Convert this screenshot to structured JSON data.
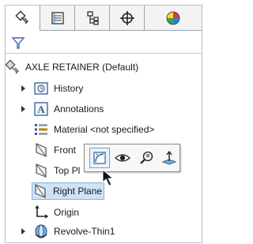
{
  "tabs": [
    {
      "name": "featuremanager-tab",
      "icon": "featuremanager-icon",
      "active": true
    },
    {
      "name": "propertymanager-tab",
      "icon": "propertymanager-icon",
      "active": false
    },
    {
      "name": "configurationmanager-tab",
      "icon": "configurationmanager-icon",
      "active": false
    },
    {
      "name": "dimxpert-tab",
      "icon": "crosshair-icon",
      "active": false
    },
    {
      "name": "display-tab",
      "icon": "color-sphere-icon",
      "active": false
    }
  ],
  "filter": {
    "icon": "filter-icon"
  },
  "tree": {
    "root": {
      "label": "AXLE RETAINER  (Default)",
      "icon": "part-icon"
    },
    "items": [
      {
        "label": "History",
        "icon": "history-icon",
        "expandable": true
      },
      {
        "label": "Annotations",
        "icon": "annotations-icon",
        "expandable": true
      },
      {
        "label": "Material <not specified>",
        "icon": "material-icon",
        "expandable": false
      },
      {
        "label": "Front",
        "icon": "plane-icon",
        "expandable": false
      },
      {
        "label": "Top Pl",
        "icon": "plane-icon",
        "expandable": false
      },
      {
        "label": "Right Plane",
        "icon": "plane-icon",
        "expandable": false,
        "selected": true
      },
      {
        "label": "Origin",
        "icon": "origin-icon",
        "expandable": false
      },
      {
        "label": "Revolve-Thin1",
        "icon": "revolve-icon",
        "expandable": true
      }
    ]
  },
  "context_toolbar": {
    "buttons": [
      "sketch-icon",
      "show-hide-icon",
      "zoom-to-selection-icon",
      "normal-to-icon"
    ]
  },
  "colors": {
    "selection": "#cfe3f7",
    "selection_border": "#87b2dc",
    "border": "#9aa4ae"
  }
}
